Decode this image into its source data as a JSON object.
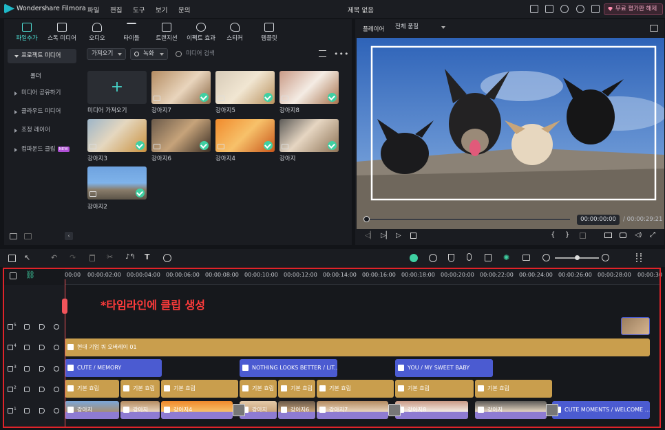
{
  "app": {
    "name": "Wondershare Filmora",
    "document_title": "제목 없음",
    "trial_button": "무료 평가판 해제"
  },
  "menu": [
    "파일",
    "편집",
    "도구",
    "보기",
    "문의"
  ],
  "toolbar": [
    {
      "label": "파일추가",
      "icon": "import-icon",
      "active": true
    },
    {
      "label": "스톡 미디어",
      "icon": "stock-media-icon"
    },
    {
      "label": "오디오",
      "icon": "music-note-icon"
    },
    {
      "label": "타이틀",
      "icon": "title-t-icon"
    },
    {
      "label": "트랜지션",
      "icon": "transition-icon"
    },
    {
      "label": "이펙트 효과",
      "icon": "effects-sparkle-icon"
    },
    {
      "label": "스티커",
      "icon": "sticker-icon"
    },
    {
      "label": "템플릿",
      "icon": "template-icon"
    }
  ],
  "left_nav": {
    "project_media": "프로젝트 미디어",
    "folder": "폴더",
    "items": [
      "미디어 공유하기",
      "클라우드 미디어",
      "조정 레이어",
      "컴파운드 클립"
    ],
    "new_badge": "NEW"
  },
  "media_toolbar": {
    "import": "가져오기",
    "record": "녹화",
    "search_placeholder": "미디어 검색"
  },
  "media_items": [
    {
      "label": "미디어 가져오기",
      "type": "import"
    },
    {
      "label": "강아지7"
    },
    {
      "label": "강아지5"
    },
    {
      "label": "강아지8"
    },
    {
      "label": "강아지3"
    },
    {
      "label": "강아지6"
    },
    {
      "label": "강아지4"
    },
    {
      "label": "강아지"
    },
    {
      "label": "강아지2"
    }
  ],
  "preview": {
    "label": "플레이어",
    "quality": "전체 품질",
    "current_time": "00:00:00:00",
    "total_time": "/ 00:00:29:21"
  },
  "ruler_ticks": [
    "00:00",
    "00:00:02:00",
    "00:00:04:00",
    "00:00:06:00",
    "00:00:08:00",
    "00:00:10:00",
    "00:00:12:00",
    "00:00:14:00",
    "00:00:16:00",
    "00:00:18:00",
    "00:00:20:00",
    "00:00:22:00",
    "00:00:24:00",
    "00:00:26:00",
    "00:00:28:00",
    "00:00:30"
  ],
  "annotation": "*타임라인에 클립 생성",
  "tracks": [
    {
      "num": "5",
      "clips": []
    },
    {
      "num": "4",
      "clips": [
        {
          "label": "현대 기업 쿼 오버레이 01"
        }
      ]
    },
    {
      "num": "3",
      "clips": [
        {
          "label": "CUTE / MEMORY"
        },
        {
          "label": "NOTHING LOOKS BETTER / LIT..."
        },
        {
          "label": "YOU / MY SWEET BABY"
        }
      ]
    },
    {
      "num": "2",
      "clips": [
        {
          "label": "기본 효림"
        },
        {
          "label": "기본 효림"
        },
        {
          "label": "기본 효림"
        },
        {
          "label": "기본 효림"
        },
        {
          "label": "기본 효림"
        },
        {
          "label": "기본 효림"
        },
        {
          "label": "기본 효림"
        },
        {
          "label": "기본 효림"
        }
      ]
    },
    {
      "num": "1",
      "clips": [
        {
          "label": "강아지"
        },
        {
          "label": "강아지"
        },
        {
          "label": "강아지4"
        },
        {
          "label": "강아지"
        },
        {
          "label": "강아지6"
        },
        {
          "label": "강아지7"
        },
        {
          "label": "강아지8"
        },
        {
          "label": "강아지"
        },
        {
          "label": "CUTE MOMENTS / WELCOME ..."
        }
      ]
    }
  ],
  "colors": {
    "accent": "#4fe0d6",
    "text_clip": "#4b5bd1",
    "title_clip": "#c99e4d",
    "video_clip": "#8e7bd2",
    "annotation": "#ff3b3b",
    "playhead": "#f2545b"
  }
}
